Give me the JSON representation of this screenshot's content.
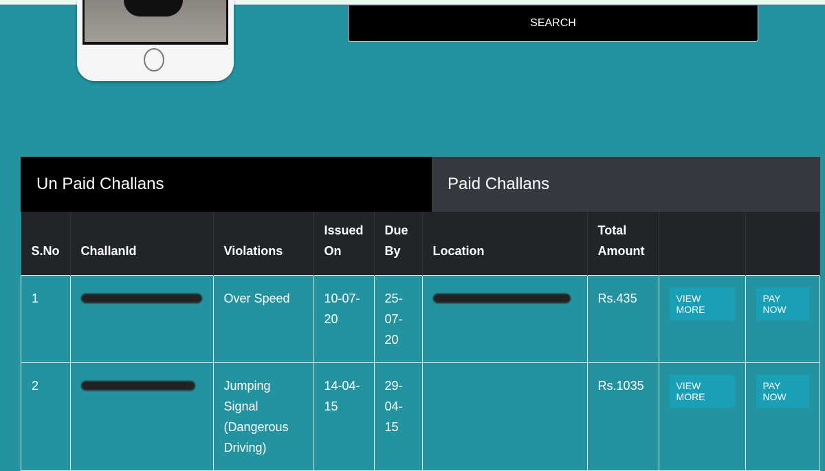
{
  "search": {
    "label": "SEARCH"
  },
  "tabs": [
    {
      "label": "Un Paid Challans"
    },
    {
      "label": "Paid Challans"
    }
  ],
  "table": {
    "headers": [
      "S.No",
      "ChallanId",
      "Violations",
      "Issued On",
      "Due By",
      "Location",
      "Total Amount",
      "",
      ""
    ],
    "rows": [
      {
        "sno": "1",
        "violation": "Over Speed",
        "issued": "10-07-20",
        "due": "25-07-20",
        "amount": "Rs.435",
        "view": "VIEW MORE",
        "pay": "PAY NOW"
      },
      {
        "sno": "2",
        "violation": "Jumping Signal (Dangerous Driving)",
        "issued": "14-04-15",
        "due": "29-04-15",
        "amount": "Rs.1035",
        "view": "VIEW MORE",
        "pay": "PAY NOW"
      }
    ]
  },
  "colors": {
    "background": "#2393a0",
    "header": "#212529",
    "button": "#199fb6"
  }
}
